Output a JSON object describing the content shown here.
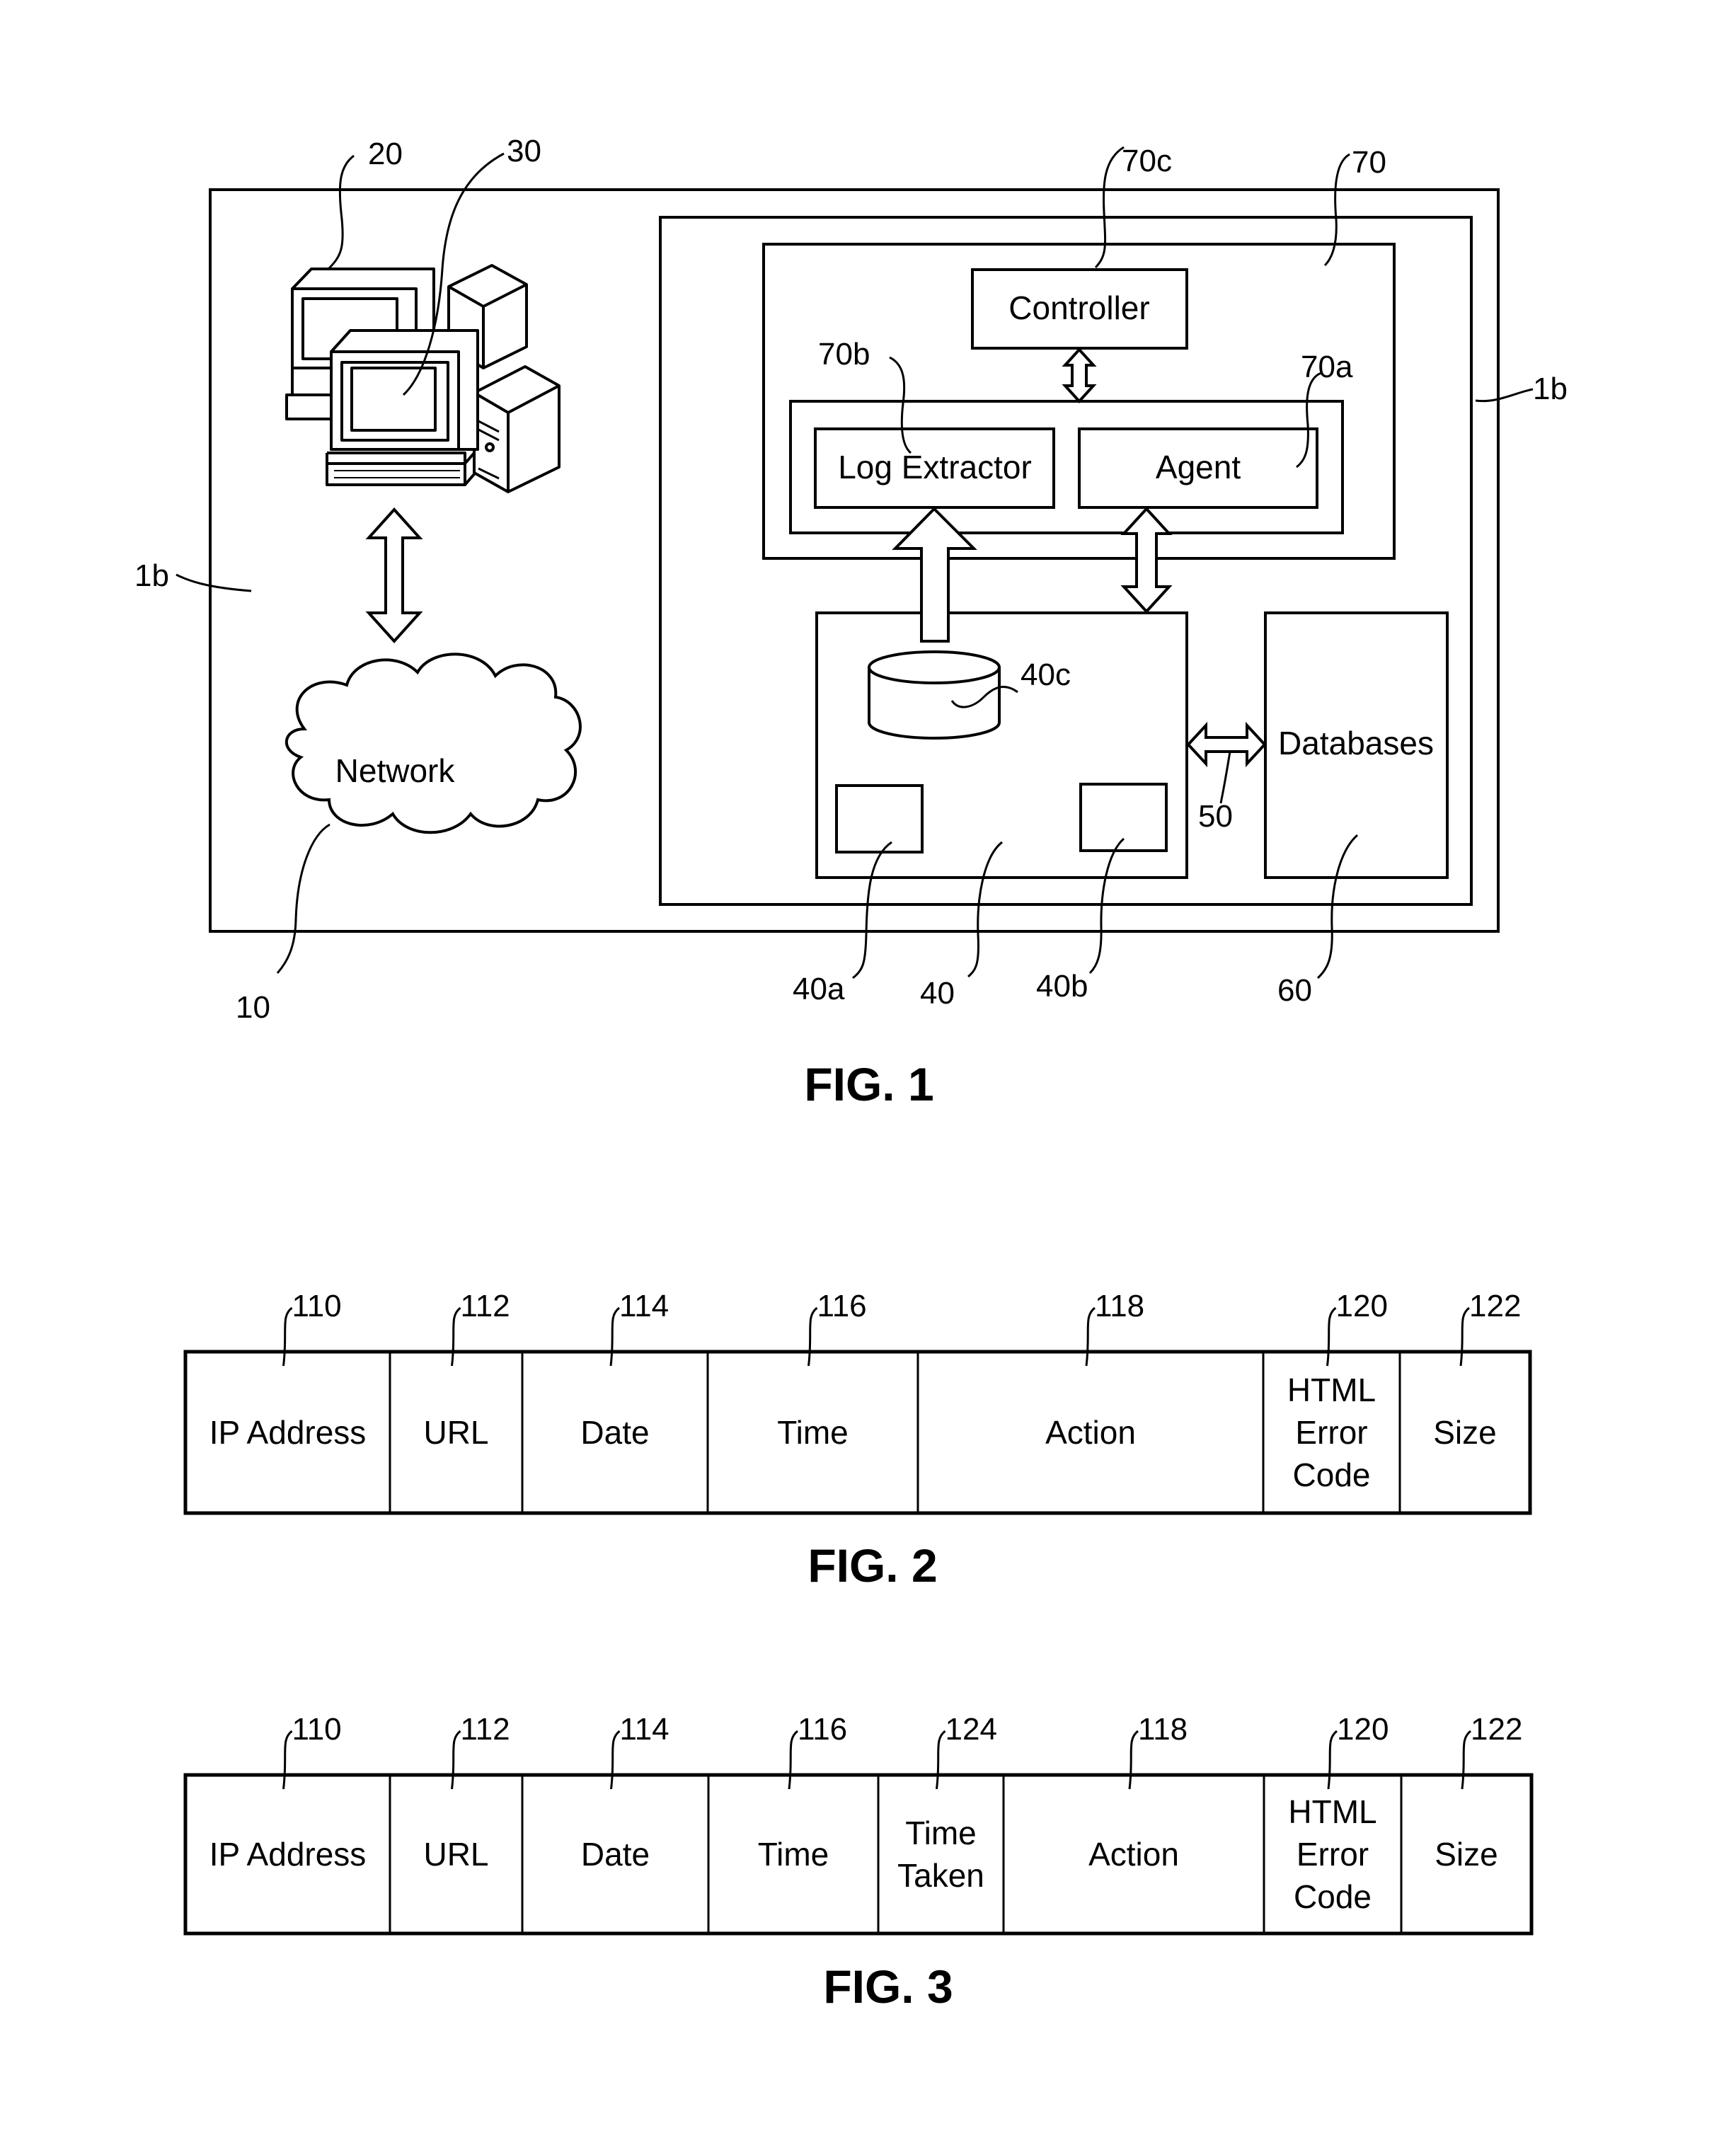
{
  "fig1": {
    "caption": "FIG. 1",
    "labels": {
      "network": "Network",
      "controller": "Controller",
      "log_extractor": "Log Extractor",
      "agent": "Agent",
      "databases": "Databases"
    },
    "refs": {
      "r10": "10",
      "r20": "20",
      "r30": "30",
      "r1b_left": "1b",
      "r1b_right": "1b",
      "r70": "70",
      "r70a": "70a",
      "r70b": "70b",
      "r70c": "70c",
      "r40": "40",
      "r40a": "40a",
      "r40b": "40b",
      "r40c": "40c",
      "r50": "50",
      "r60": "60"
    }
  },
  "fig2": {
    "caption": "FIG. 2",
    "columns": [
      {
        "ref": "110",
        "lines": [
          "IP Address"
        ]
      },
      {
        "ref": "112",
        "lines": [
          "URL"
        ]
      },
      {
        "ref": "114",
        "lines": [
          "Date"
        ]
      },
      {
        "ref": "116",
        "lines": [
          "Time"
        ]
      },
      {
        "ref": "118",
        "lines": [
          "Action"
        ]
      },
      {
        "ref": "120",
        "lines": [
          "HTML",
          "Error",
          "Code"
        ]
      },
      {
        "ref": "122",
        "lines": [
          "Size"
        ]
      }
    ]
  },
  "fig3": {
    "caption": "FIG. 3",
    "columns": [
      {
        "ref": "110",
        "lines": [
          "IP Address"
        ]
      },
      {
        "ref": "112",
        "lines": [
          "URL"
        ]
      },
      {
        "ref": "114",
        "lines": [
          "Date"
        ]
      },
      {
        "ref": "116",
        "lines": [
          "Time"
        ]
      },
      {
        "ref": "124",
        "lines": [
          "Time",
          "Taken"
        ]
      },
      {
        "ref": "118",
        "lines": [
          "Action"
        ]
      },
      {
        "ref": "120",
        "lines": [
          "HTML",
          "Error",
          "Code"
        ]
      },
      {
        "ref": "122",
        "lines": [
          "Size"
        ]
      }
    ]
  }
}
